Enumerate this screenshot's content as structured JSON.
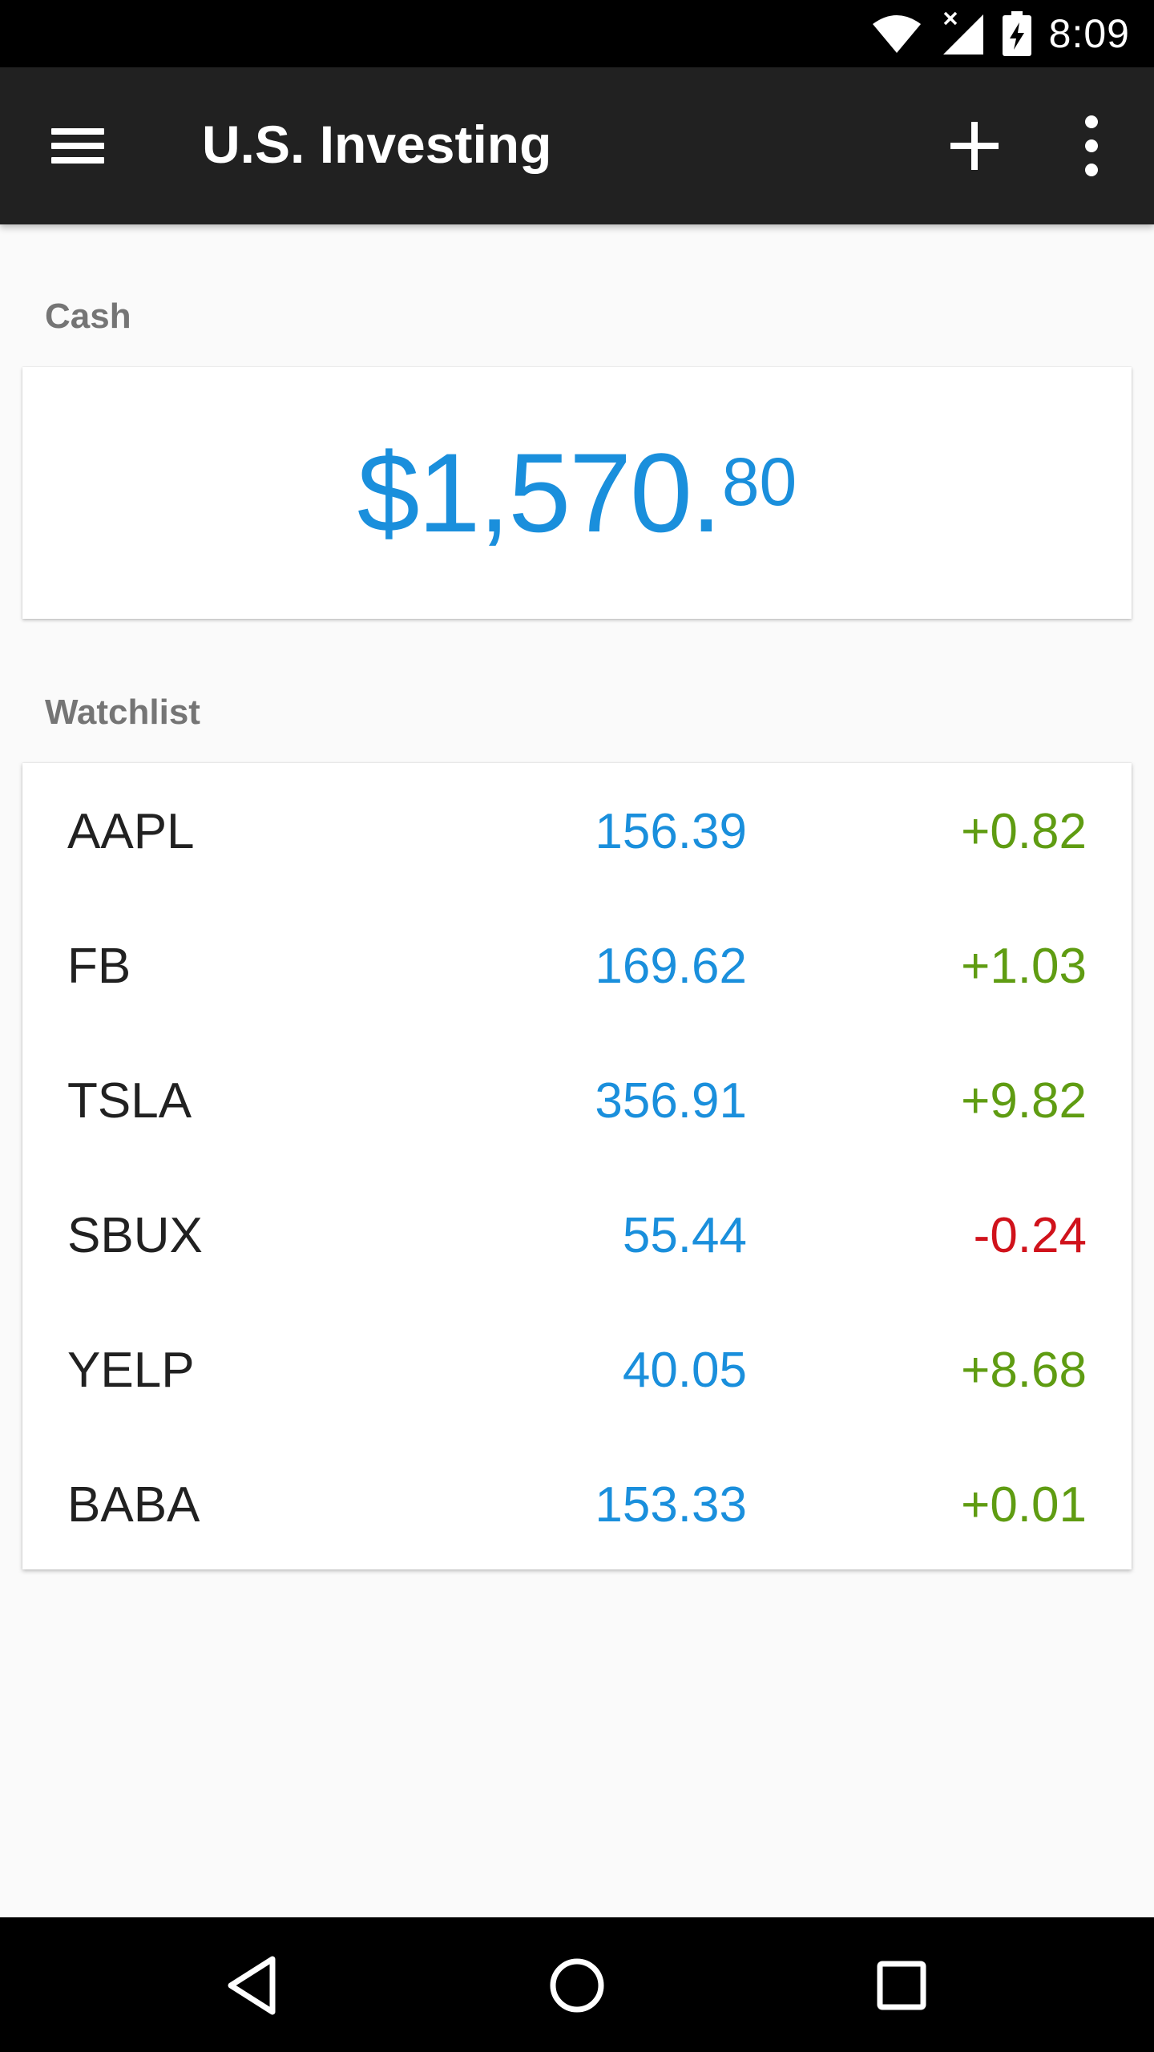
{
  "status_bar": {
    "time": "8:09",
    "icons": [
      "wifi-icon",
      "signal-icon",
      "battery-charging-icon"
    ]
  },
  "app_bar": {
    "title": "U.S. Investing",
    "icons": [
      "menu-icon",
      "add-icon",
      "more-vert-icon"
    ]
  },
  "cash": {
    "label": "Cash",
    "amount_main": "$1,570.",
    "amount_cents": "80"
  },
  "watchlist": {
    "label": "Watchlist",
    "items": [
      {
        "symbol": "AAPL",
        "price": "156.39",
        "change": "+0.82"
      },
      {
        "symbol": "FB",
        "price": "169.62",
        "change": "+1.03"
      },
      {
        "symbol": "TSLA",
        "price": "356.91",
        "change": "+9.82"
      },
      {
        "symbol": "SBUX",
        "price": "55.44",
        "change": "-0.24"
      },
      {
        "symbol": "YELP",
        "price": "40.05",
        "change": "+8.68"
      },
      {
        "symbol": "BABA",
        "price": "153.33",
        "change": "+0.01"
      }
    ]
  },
  "nav_bar": {
    "icons": [
      "back-icon",
      "home-icon",
      "recents-icon"
    ]
  },
  "colors": {
    "app_bar": "#212121",
    "accent_blue": "#1a8fdc",
    "positive_green": "#5f9c12",
    "negative_red": "#d0121b",
    "background": "#fafafa"
  }
}
